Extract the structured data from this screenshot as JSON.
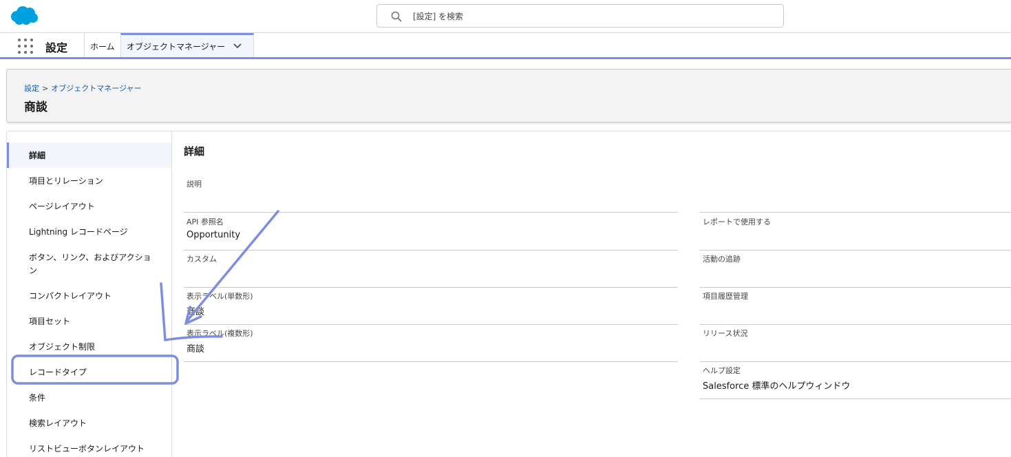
{
  "search": {
    "placeholder": "[設定] を検索"
  },
  "nav": {
    "app_name": "設定",
    "home_tab": "ホーム",
    "object_manager_tab": "オブジェクトマネージャー"
  },
  "page_header": {
    "breadcrumb_root": "設定",
    "breadcrumb_separator": ">",
    "breadcrumb_current": "オブジェクトマネージャー",
    "title": "商談"
  },
  "sidebar": {
    "items": [
      {
        "label": "詳細"
      },
      {
        "label": "項目とリレーション"
      },
      {
        "label": "ページレイアウト"
      },
      {
        "label": "Lightning レコードページ"
      },
      {
        "label": "ボタン、リンク、およびアクション"
      },
      {
        "label": "コンパクトレイアウト"
      },
      {
        "label": "項目セット"
      },
      {
        "label": "オブジェクト制限"
      },
      {
        "label": "レコードタイプ"
      },
      {
        "label": "条件"
      },
      {
        "label": "検索レイアウト"
      },
      {
        "label": "リストビューボタンレイアウト"
      }
    ]
  },
  "details": {
    "section_title": "詳細",
    "left_fields": [
      {
        "label": "説明",
        "value": ""
      },
      {
        "label": "API 参照名",
        "value": "Opportunity"
      },
      {
        "label": "カスタム",
        "value": ""
      },
      {
        "label": "表示ラベル(単数形)",
        "value": "商談"
      },
      {
        "label": "表示ラベル(複数形)",
        "value": "商談"
      }
    ],
    "right_fields": [
      {
        "label": "レポートで使用する",
        "value": ""
      },
      {
        "label": "活動の追跡",
        "value": ""
      },
      {
        "label": "項目履歴管理",
        "value": ""
      },
      {
        "label": "リリース状況",
        "value": ""
      },
      {
        "label": "ヘルプ設定",
        "value": "Salesforce 標準のヘルプウィンドウ"
      }
    ]
  },
  "colors": {
    "brand": "#00a1e0",
    "accent": "#7f8de1",
    "link": "#0b5cab"
  }
}
